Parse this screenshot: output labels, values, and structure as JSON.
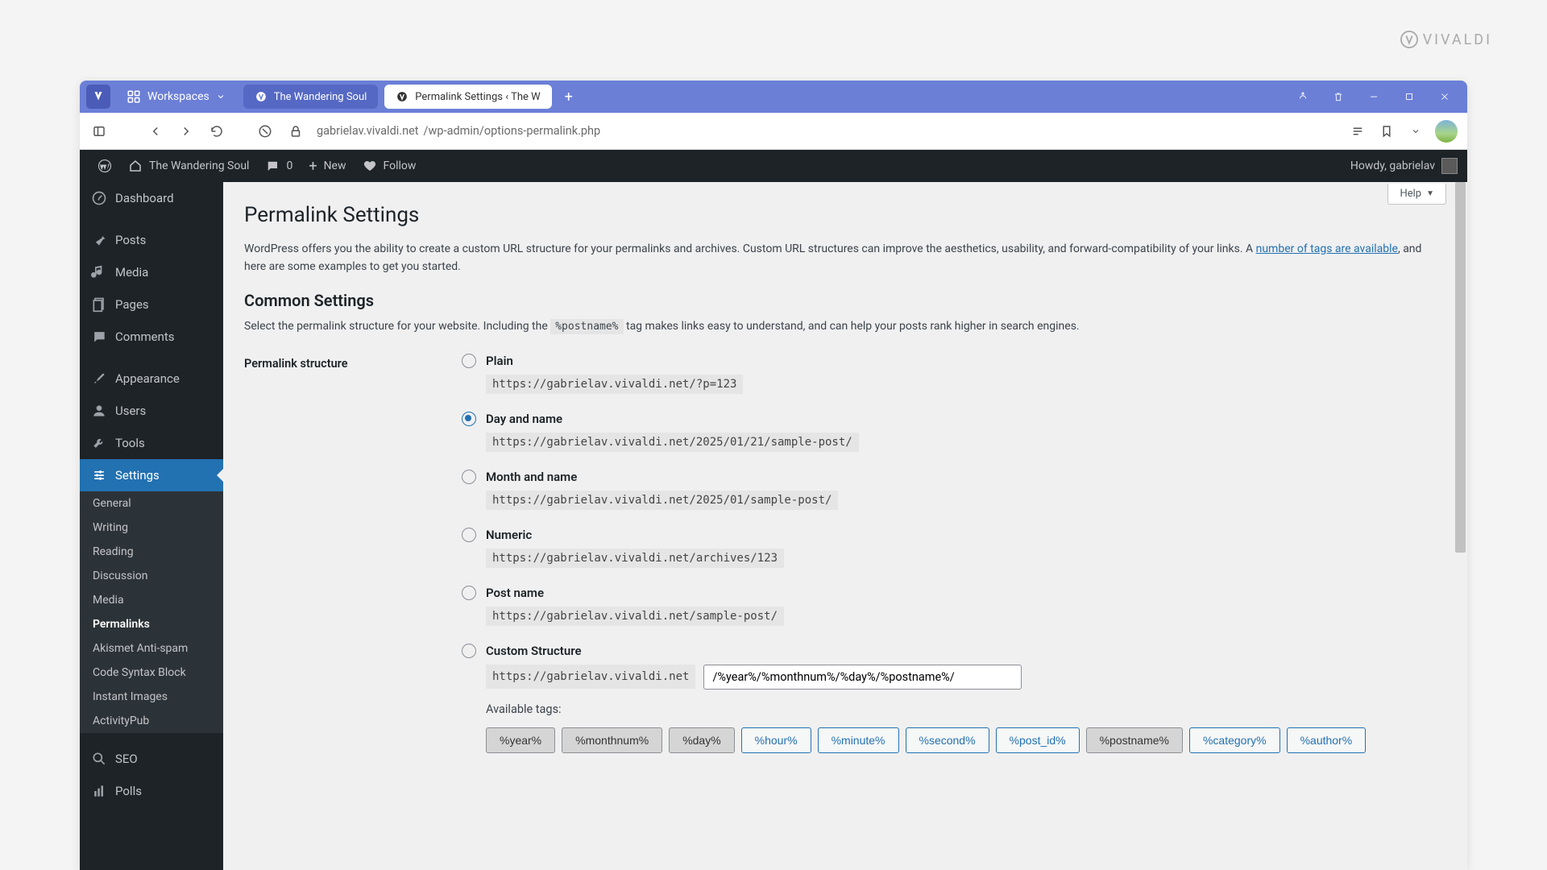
{
  "watermark": "VIVALDI",
  "titlebar": {
    "workspaces": "Workspaces",
    "tabs": [
      {
        "label": "The Wandering Soul",
        "active": false
      },
      {
        "label": "Permalink Settings ‹ The W",
        "active": true
      }
    ]
  },
  "addressbar": {
    "url_host": "gabrielav.vivaldi.net",
    "url_path": "/wp-admin/options-permalink.php"
  },
  "wp_adminbar": {
    "site_title": "The Wandering Soul",
    "comments": "0",
    "new": "New",
    "follow": "Follow",
    "howdy": "Howdy, gabrielav"
  },
  "sidebar": {
    "items": [
      {
        "label": "Dashboard",
        "icon": "dashboard"
      },
      {
        "label": "Posts",
        "icon": "pin"
      },
      {
        "label": "Media",
        "icon": "media"
      },
      {
        "label": "Pages",
        "icon": "page"
      },
      {
        "label": "Comments",
        "icon": "comment"
      },
      {
        "label": "Appearance",
        "icon": "brush"
      },
      {
        "label": "Users",
        "icon": "user"
      },
      {
        "label": "Tools",
        "icon": "wrench"
      },
      {
        "label": "Settings",
        "icon": "sliders",
        "active": true
      },
      {
        "label": "SEO",
        "icon": "seo"
      },
      {
        "label": "Polls",
        "icon": "bars"
      }
    ],
    "submenu": [
      "General",
      "Writing",
      "Reading",
      "Discussion",
      "Media",
      "Permalinks",
      "Akismet Anti-spam",
      "Code Syntax Block",
      "Instant Images",
      "ActivityPub"
    ],
    "submenu_current": "Permalinks"
  },
  "content": {
    "help": "Help",
    "heading": "Permalink Settings",
    "intro_before": "WordPress offers you the ability to create a custom URL structure for your permalinks and archives. Custom URL structures can improve the aesthetics, usability, and forward-compatibility of your links. A ",
    "intro_link": "number of tags are available",
    "intro_after": ", and here are some examples to get you started.",
    "h2": "Common Settings",
    "desc_before": "Select the permalink structure for your website. Including the ",
    "desc_code": "%postname%",
    "desc_after": " tag makes links easy to understand, and can help your posts rank higher in search engines.",
    "form_label": "Permalink structure",
    "options": [
      {
        "label": "Plain",
        "example": "https://gabrielav.vivaldi.net/?p=123",
        "checked": false
      },
      {
        "label": "Day and name",
        "example": "https://gabrielav.vivaldi.net/2025/01/21/sample-post/",
        "checked": true
      },
      {
        "label": "Month and name",
        "example": "https://gabrielav.vivaldi.net/2025/01/sample-post/",
        "checked": false
      },
      {
        "label": "Numeric",
        "example": "https://gabrielav.vivaldi.net/archives/123",
        "checked": false
      },
      {
        "label": "Post name",
        "example": "https://gabrielav.vivaldi.net/sample-post/",
        "checked": false
      }
    ],
    "custom_label": "Custom Structure",
    "custom_base": "https://gabrielav.vivaldi.net",
    "custom_value": "/%year%/%monthnum%/%day%/%postname%/",
    "avail_label": "Available tags:",
    "tags": [
      {
        "label": "%year%",
        "selected": true
      },
      {
        "label": "%monthnum%",
        "selected": true
      },
      {
        "label": "%day%",
        "selected": true
      },
      {
        "label": "%hour%",
        "selected": false
      },
      {
        "label": "%minute%",
        "selected": false
      },
      {
        "label": "%second%",
        "selected": false
      },
      {
        "label": "%post_id%",
        "selected": false
      },
      {
        "label": "%postname%",
        "selected": true
      },
      {
        "label": "%category%",
        "selected": false
      },
      {
        "label": "%author%",
        "selected": false
      }
    ]
  }
}
